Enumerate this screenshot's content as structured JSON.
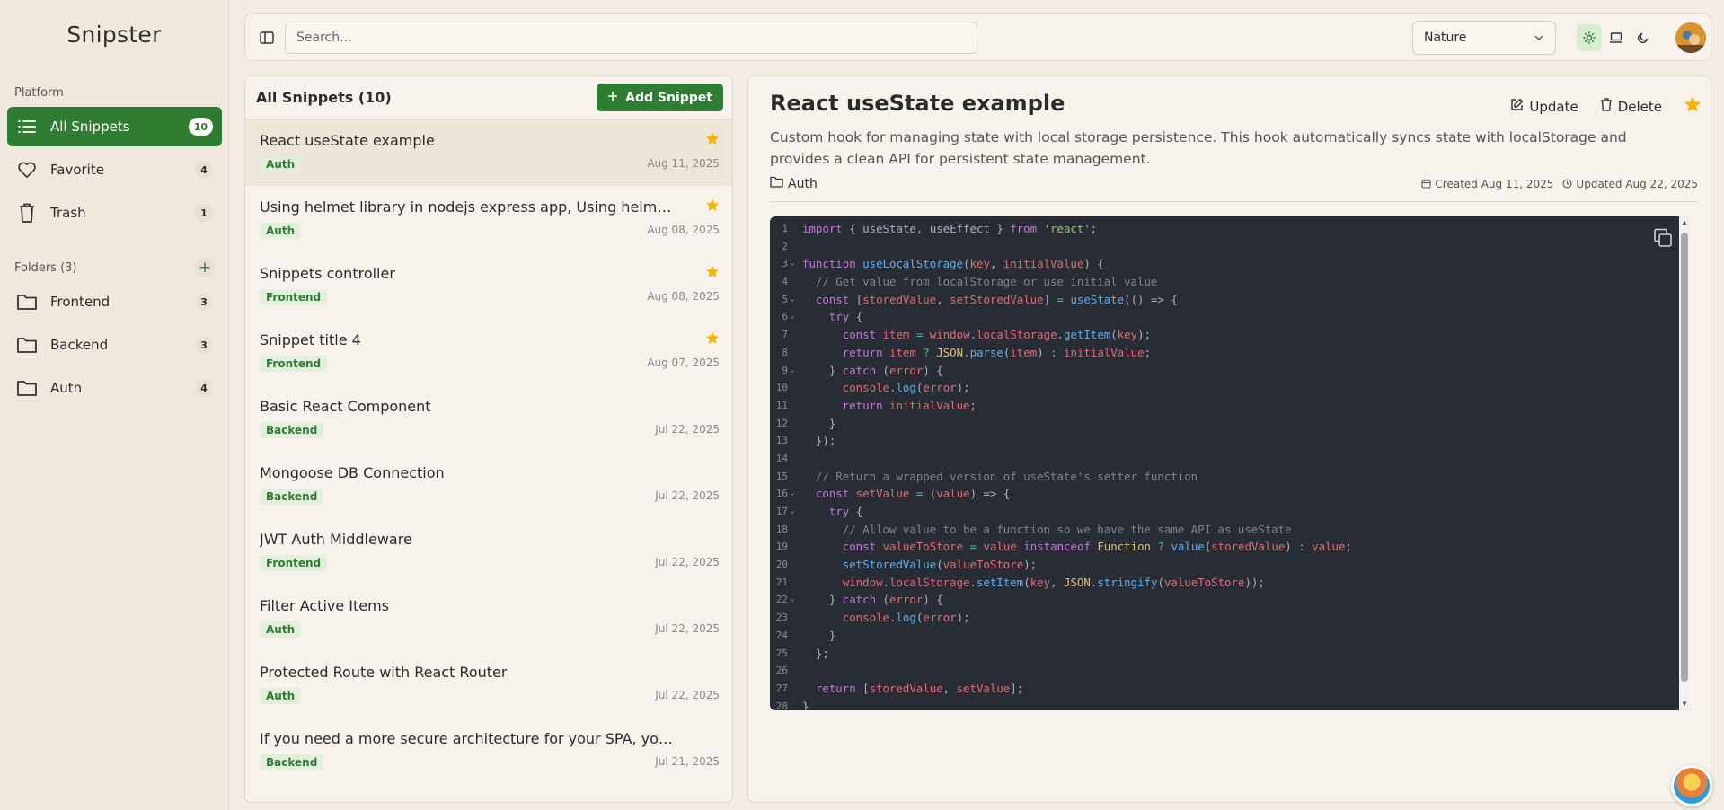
{
  "sidebar": {
    "brand": "Snipster",
    "platform_label": "Platform",
    "nav": [
      {
        "label": "All Snippets",
        "count": "10",
        "icon": "list-icon"
      },
      {
        "label": "Favorite",
        "count": "4",
        "icon": "heart-icon"
      },
      {
        "label": "Trash",
        "count": "1",
        "icon": "trash-icon"
      }
    ],
    "folders_label": "Folders (3)",
    "folders": [
      {
        "label": "Frontend",
        "count": "3"
      },
      {
        "label": "Backend",
        "count": "3"
      },
      {
        "label": "Auth",
        "count": "4"
      }
    ]
  },
  "topbar": {
    "search_placeholder": "Search...",
    "theme_value": "Nature",
    "mode": "light"
  },
  "list": {
    "title": "All Snippets (10)",
    "add_label": "Add Snippet",
    "items": [
      {
        "title": "React useState example",
        "tag": "Auth",
        "date": "Aug 11, 2025",
        "favorite": true,
        "active": true
      },
      {
        "title": "Using helmet library in nodejs express app, Using helmet library in nodejs express app",
        "tag": "Auth",
        "date": "Aug 08, 2025",
        "favorite": true
      },
      {
        "title": "Snippets controller",
        "tag": "Frontend",
        "date": "Aug 08, 2025",
        "favorite": true
      },
      {
        "title": "Snippet title 4",
        "tag": "Frontend",
        "date": "Aug 07, 2025",
        "favorite": true
      },
      {
        "title": "Basic React Component",
        "tag": "Backend",
        "date": "Jul 22, 2025",
        "favorite": false
      },
      {
        "title": "Mongoose DB Connection",
        "tag": "Backend",
        "date": "Jul 22, 2025",
        "favorite": false
      },
      {
        "title": "JWT Auth Middleware",
        "tag": "Frontend",
        "date": "Jul 22, 2025",
        "favorite": false
      },
      {
        "title": "Filter Active Items",
        "tag": "Auth",
        "date": "Jul 22, 2025",
        "favorite": false
      },
      {
        "title": "Protected Route with React Router",
        "tag": "Auth",
        "date": "Jul 22, 2025",
        "favorite": false
      },
      {
        "title": "If you need a more secure architecture for your SPA, you can use a backend",
        "tag": "Backend",
        "date": "Jul 21, 2025",
        "favorite": false
      }
    ]
  },
  "detail": {
    "title": "React useState example",
    "update_label": "Update",
    "delete_label": "Delete",
    "description": "Custom hook for managing state with local storage persistence. This hook automatically syncs state with localStorage and provides a clean API for persistent state management.",
    "folder": "Auth",
    "created": "Created Aug 11, 2025",
    "updated": "Updated Aug 22, 2025",
    "code_lines": [
      "import { useState, useEffect } from 'react';",
      "",
      "function useLocalStorage(key, initialValue) {",
      "  // Get value from localStorage or use initial value",
      "  const [storedValue, setStoredValue] = useState(() => {",
      "    try {",
      "      const item = window.localStorage.getItem(key);",
      "      return item ? JSON.parse(item) : initialValue;",
      "    } catch (error) {",
      "      console.log(error);",
      "      return initialValue;",
      "    }",
      "  });",
      "",
      "  // Return a wrapped version of useState's setter function",
      "  const setValue = (value) => {",
      "    try {",
      "      // Allow value to be a function so we have the same API as useState",
      "      const valueToStore = value instanceof Function ? value(storedValue) : value;",
      "      setStoredValue(valueToStore);",
      "      window.localStorage.setItem(key, JSON.stringify(valueToStore));",
      "    } catch (error) {",
      "      console.log(error);",
      "    }",
      "  };",
      "",
      "  return [storedValue, setValue];",
      "}"
    ]
  },
  "colors": {
    "accent": "#2f7d32",
    "star": "#f5b400",
    "code_bg": "#282c34"
  }
}
